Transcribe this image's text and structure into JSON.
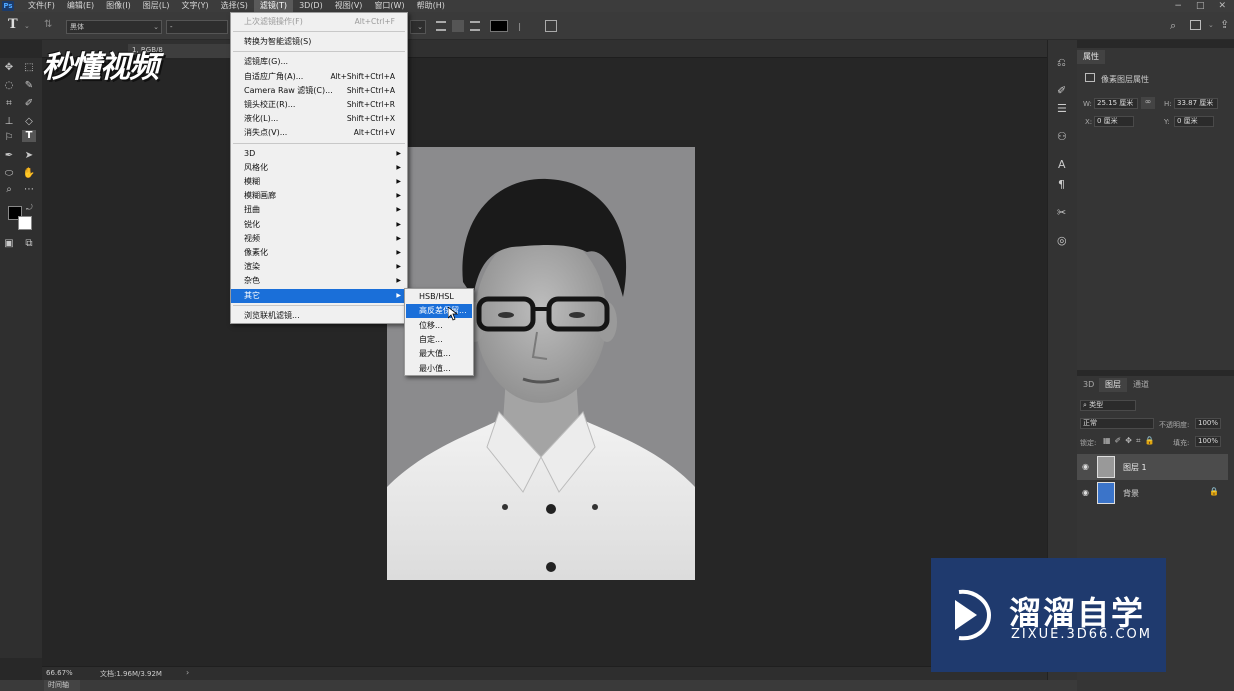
{
  "menubar": {
    "logo": "Ps",
    "items": [
      "文件(F)",
      "编辑(E)",
      "图像(I)",
      "图层(L)",
      "文字(Y)",
      "选择(S)",
      "滤镜(T)",
      "3D(D)",
      "视图(V)",
      "窗口(W)",
      "帮助(H)"
    ],
    "active_index": 6,
    "window_controls": [
      "−",
      "□",
      "✕"
    ]
  },
  "options_bar": {
    "tool_glyph": "T",
    "font_family": "黑体",
    "font_style": "-"
  },
  "document": {
    "tab_text": "1, RGB/8",
    "zoom": "66.67%",
    "doc_info": "文档:1.96M/3.92M"
  },
  "timeline_tab": "时间轴",
  "filter_menu": {
    "items": [
      {
        "label": "上次滤镜操作(F)",
        "shortcut": "Alt+Ctrl+F",
        "disabled": true
      },
      {
        "sep": true
      },
      {
        "label": "转换为智能滤镜(S)"
      },
      {
        "sep": true
      },
      {
        "label": "滤镜库(G)..."
      },
      {
        "label": "自适应广角(A)...",
        "shortcut": "Alt+Shift+Ctrl+A"
      },
      {
        "label": "Camera Raw 滤镜(C)...",
        "shortcut": "Shift+Ctrl+A"
      },
      {
        "label": "镜头校正(R)...",
        "shortcut": "Shift+Ctrl+R"
      },
      {
        "label": "液化(L)...",
        "shortcut": "Shift+Ctrl+X"
      },
      {
        "label": "消失点(V)...",
        "shortcut": "Alt+Ctrl+V"
      },
      {
        "sep": true
      },
      {
        "label": "3D",
        "submenu": true
      },
      {
        "label": "风格化",
        "submenu": true
      },
      {
        "label": "模糊",
        "submenu": true
      },
      {
        "label": "模糊画廊",
        "submenu": true
      },
      {
        "label": "扭曲",
        "submenu": true
      },
      {
        "label": "锐化",
        "submenu": true
      },
      {
        "label": "视频",
        "submenu": true
      },
      {
        "label": "像素化",
        "submenu": true
      },
      {
        "label": "渲染",
        "submenu": true
      },
      {
        "label": "杂色",
        "submenu": true
      },
      {
        "label": "其它",
        "submenu": true,
        "highlighted": true
      },
      {
        "sep": true
      },
      {
        "label": "浏览联机滤镜..."
      }
    ]
  },
  "submenu_other": {
    "items": [
      "HSB/HSL",
      "高反差保留...",
      "位移...",
      "自定...",
      "最大值...",
      "最小值..."
    ],
    "highlighted_index": 1
  },
  "properties_panel": {
    "tab": "属性",
    "title": "像素图层属性",
    "w_label": "W:",
    "w_value": "25.15 厘米",
    "h_label": "H:",
    "h_value": "33.87 厘米",
    "x_label": "X:",
    "x_value": "0 厘米",
    "y_label": "Y:",
    "y_value": "0 厘米"
  },
  "layers_panel": {
    "tabs": [
      "3D",
      "图层",
      "通道"
    ],
    "active_tab": 1,
    "filter_label": "类型",
    "blend_mode": "正常",
    "opacity_label": "不透明度:",
    "opacity_value": "100%",
    "lock_label": "锁定:",
    "fill_label": "填充:",
    "fill_value": "100%",
    "layers": [
      {
        "name": "图层 1",
        "selected": true
      },
      {
        "name": "背景",
        "locked": true
      }
    ]
  },
  "watermark_left": "秒懂视频",
  "watermark_right": {
    "title": "溜溜自学",
    "url": "ZIXUE.3D66.COM"
  },
  "colors": {
    "menu_highlight": "#1a6fd9",
    "watermark_bg": "#1f3a6e"
  }
}
